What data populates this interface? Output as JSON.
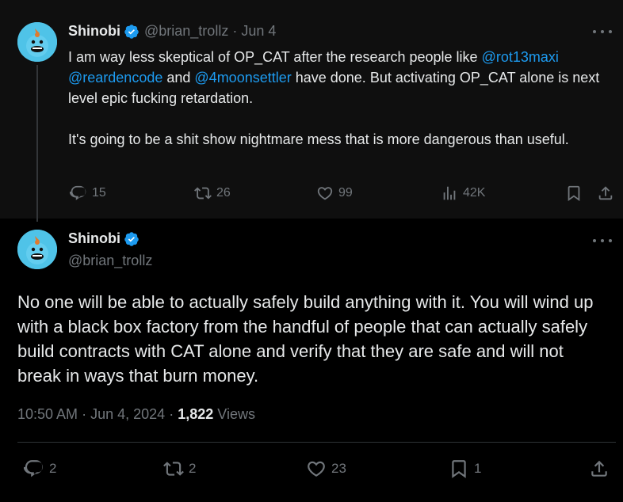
{
  "parent": {
    "display_name": "Shinobi",
    "handle": "@brian_trollz",
    "separator": "·",
    "date": "Jun 4",
    "text_before": "I am way less skeptical of OP_CAT after the research people like ",
    "mention1": "@rot13maxi",
    "mention2": "@reardencode",
    "text_and": " and ",
    "mention3": "@4moonsettler",
    "text_after": " have done. But activating OP_CAT alone is next level epic fucking retardation.\n\nIt's going to be a shit show nightmare mess that is more dangerous than useful.",
    "replies": "15",
    "reposts": "26",
    "likes": "99",
    "views": "42K"
  },
  "main": {
    "display_name": "Shinobi",
    "handle": "@brian_trollz",
    "text": "No one will be able to actually safely build anything with it. You will wind up with a black box factory from the handful of people that can actually safely build contracts with CAT alone and verify that they are safe and will not break in ways that burn money.",
    "time": "10:50 AM",
    "separator": "·",
    "date": "Jun 4, 2024",
    "views_count": "1,822",
    "views_label": "Views",
    "replies": "2",
    "reposts": "2",
    "likes": "23",
    "bookmarks": "1"
  },
  "colors": {
    "background": "#000000",
    "parent_background": "#0f0f0f",
    "text": "#e7e9ea",
    "muted": "#71767b",
    "accent": "#1d9bf0",
    "avatar_blue": "#4fc3e8"
  },
  "icons": {
    "verified": "verified-badge-icon",
    "more": "more-horizontal-icon",
    "reply": "reply-icon",
    "repost": "repost-icon",
    "like": "heart-icon",
    "views": "views-chart-icon",
    "bookmark": "bookmark-icon",
    "share": "share-icon"
  }
}
